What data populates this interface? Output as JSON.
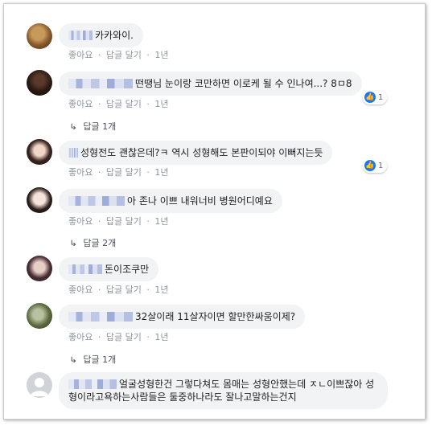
{
  "action_labels": {
    "like": "좋아요",
    "reply": "답글 달기",
    "sep": "·"
  },
  "comments": [
    {
      "text": "카카와이.",
      "time": "1년"
    },
    {
      "text": "떤땡님 눈이랑 코만하면 이로케 될 수 인나여...? 8ㅁ8",
      "time": "1년",
      "likes": "1",
      "replies": "답글 1개"
    },
    {
      "text": "성형전도 괜찮은데?ㅋ 역시 성형해도 본판이되야 이뻐지는듯",
      "time": "1년",
      "likes": "1"
    },
    {
      "text": "아 존나 이쁘 내워너비 병원어디예요",
      "time": "1년",
      "replies": "답글 2개"
    },
    {
      "text": "돈이조쿠만",
      "time": "1년"
    },
    {
      "text": "32살이래 11살자이면 할만한싸움이제?",
      "time": "1년",
      "replies": "답글 1개"
    },
    {
      "text": "얼굴성형한건 그렇다쳐도 몸매는 성형안했는데 ㅈㄴ이쁘잖아 성형이라고욕하는사람들은 둘중하나라도 잘나고말하는건지"
    }
  ],
  "colors": {
    "bubble": "#f2f3f5",
    "meta": "#8d949e",
    "like_blue": "#1877f2"
  },
  "icons": {
    "like": "thumbs-up-icon",
    "reply_arrow": "reply-arrow-icon",
    "avatar_placeholder": "default-avatar-icon"
  }
}
